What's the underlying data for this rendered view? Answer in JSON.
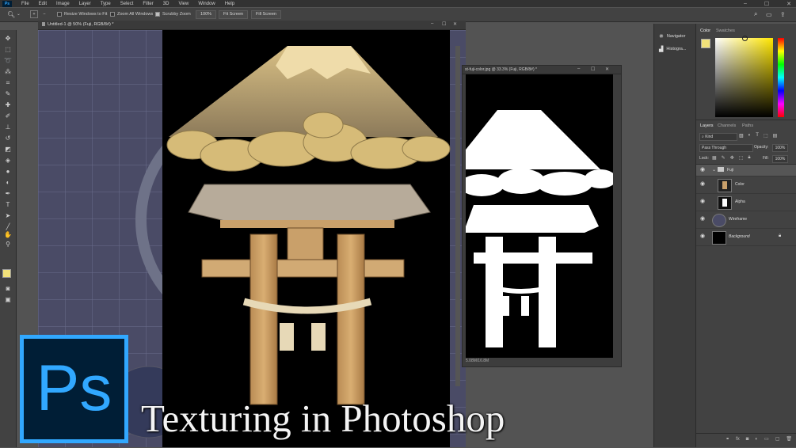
{
  "app": {
    "logo": "Ps"
  },
  "menu": [
    "File",
    "Edit",
    "Image",
    "Layer",
    "Type",
    "Select",
    "Filter",
    "3D",
    "View",
    "Window",
    "Help"
  ],
  "window_controls": [
    "minimize-icon",
    "maximize-icon",
    "close-icon"
  ],
  "options_bar": {
    "resize_windows_label": "Resize Windows to Fit",
    "resize_windows_checked": false,
    "zoom_all_label": "Zoom All Windows",
    "zoom_all_checked": false,
    "scrubby_zoom_label": "Scrubby Zoom",
    "scrubby_zoom_checked": true,
    "percent_button": "100%",
    "fit_screen_button": "Fit Screen",
    "fill_screen_button": "Fill Screen"
  },
  "tools": [
    "move-icon",
    "marquee-icon",
    "lasso-icon",
    "magic-wand-icon",
    "crop-icon",
    "eyedropper-icon",
    "healing-icon",
    "brush-icon",
    "clone-stamp-icon",
    "history-brush-icon",
    "eraser-icon",
    "paint-bucket-icon",
    "blur-icon",
    "dodge-icon",
    "pen-icon",
    "type-icon",
    "path-select-icon",
    "line-icon",
    "hand-icon",
    "zoom-icon"
  ],
  "colors": {
    "foreground": "#f2e27a",
    "background": "#ffffff",
    "accent": "#31a8ff",
    "ps_dark": "#001e36"
  },
  "document_main": {
    "tab_title": "Untitled-1 @ 50% (Fuji, RGB/8#) *"
  },
  "document_alpha": {
    "tab_title": "st-fuji-color.jpg @ 33.3% (Fuji, RGB/8#) *",
    "status": "5.08M/16.8M"
  },
  "dock": {
    "navigator": "Navigator",
    "histogram": "Histogra..."
  },
  "color_panel": {
    "tabs": [
      "Color",
      "Swatches"
    ]
  },
  "layers_panel": {
    "tabs": [
      "Layers",
      "Channels",
      "Paths"
    ],
    "filter_kind": "Kind",
    "blend_mode": "Pass Through",
    "opacity_label": "Opacity:",
    "opacity_value": "100%",
    "lock_label": "Lock:",
    "fill_label": "Fill:",
    "fill_value": "100%",
    "layers": [
      {
        "name": "Fuji",
        "type": "group"
      },
      {
        "name": "Color",
        "type": "layer"
      },
      {
        "name": "Alpha",
        "type": "layer"
      },
      {
        "name": "Wireframe",
        "type": "layer"
      },
      {
        "name": "Background",
        "type": "layer"
      }
    ]
  },
  "overlay": {
    "logo_text": "Ps",
    "title": "Texturing in Photoshop"
  }
}
